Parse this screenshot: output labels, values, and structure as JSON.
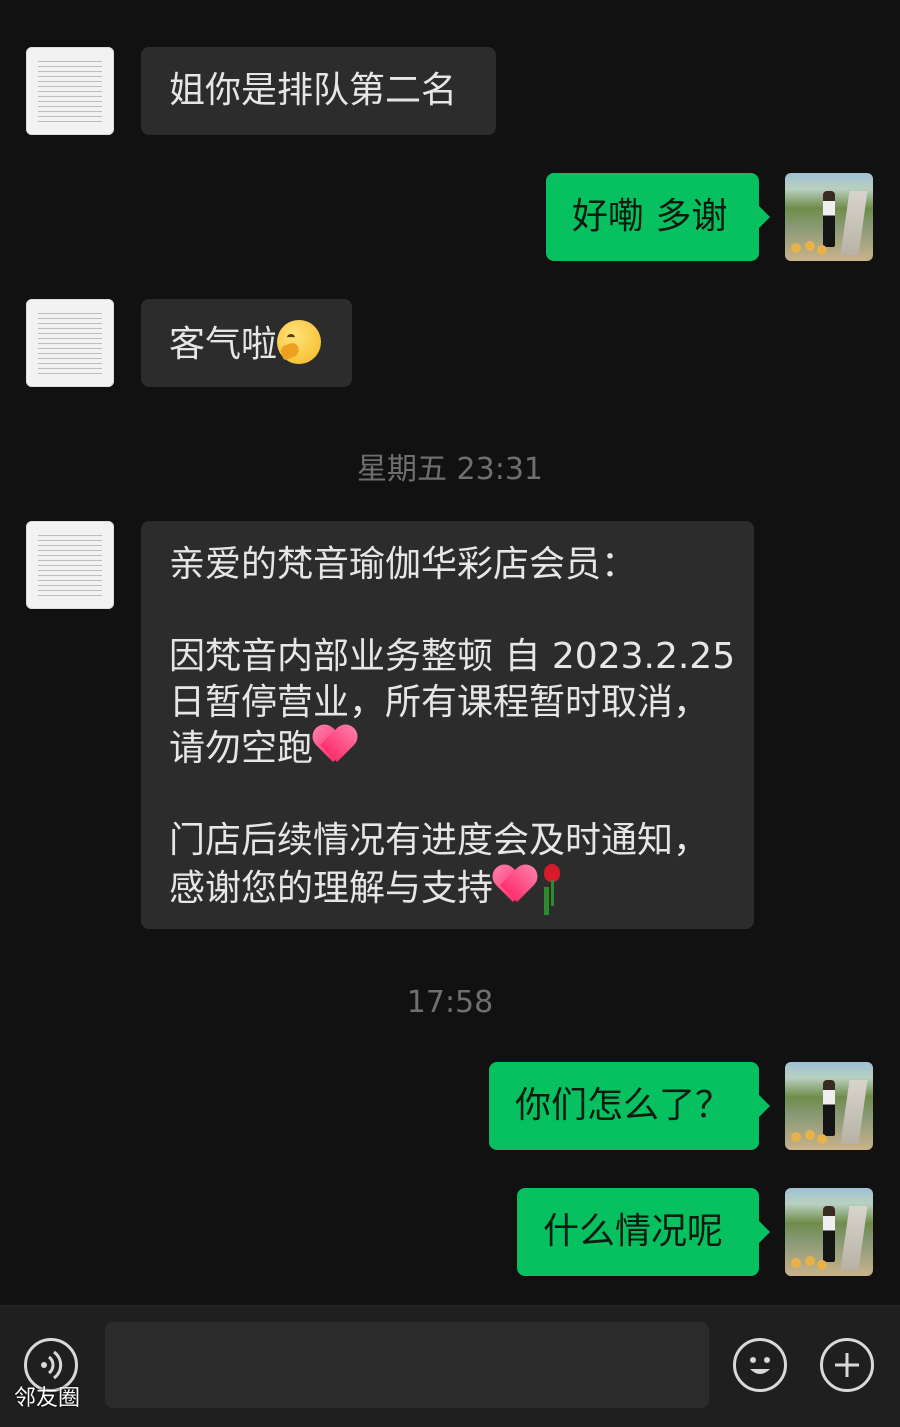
{
  "messages": [
    {
      "id": "m1",
      "side": "in",
      "text": "姐你是排队第二名"
    },
    {
      "id": "m2",
      "side": "out",
      "text": "好嘞 多谢"
    },
    {
      "id": "m3",
      "side": "in",
      "text": "客气啦",
      "emoji": "thinking-face-icon"
    },
    {
      "id": "ts1",
      "type": "timestamp",
      "text": "星期五 23:31"
    },
    {
      "id": "m4",
      "side": "in",
      "line1": "亲爱的梵音瑜伽华彩店会员：",
      "para2_line1": "因梵音内部业务整顿 自 2023.2.25",
      "para2_line2": "日暂停营业，所有课程暂时取消，",
      "para2_line3": "请勿空跑",
      "para3_line1": "门店后续情况有进度会及时通知，",
      "para3_line2": "感谢您的理解与支持",
      "emojis": [
        "heart-icon",
        "heart-icon",
        "rose-icon"
      ]
    },
    {
      "id": "ts2",
      "type": "timestamp",
      "text": "17:58"
    },
    {
      "id": "m5",
      "side": "out",
      "text": "你们怎么了？"
    },
    {
      "id": "m6",
      "side": "out",
      "text": "什么情况呢"
    }
  ],
  "input": {
    "placeholder": ""
  },
  "icons": {
    "voice": "voice-icon",
    "emoji": "emoji-icon",
    "add": "plus-icon"
  },
  "watermark": "邻友圈",
  "colors": {
    "background": "#111111",
    "incoming": "#2c2c2c",
    "outgoing": "#07c160"
  }
}
